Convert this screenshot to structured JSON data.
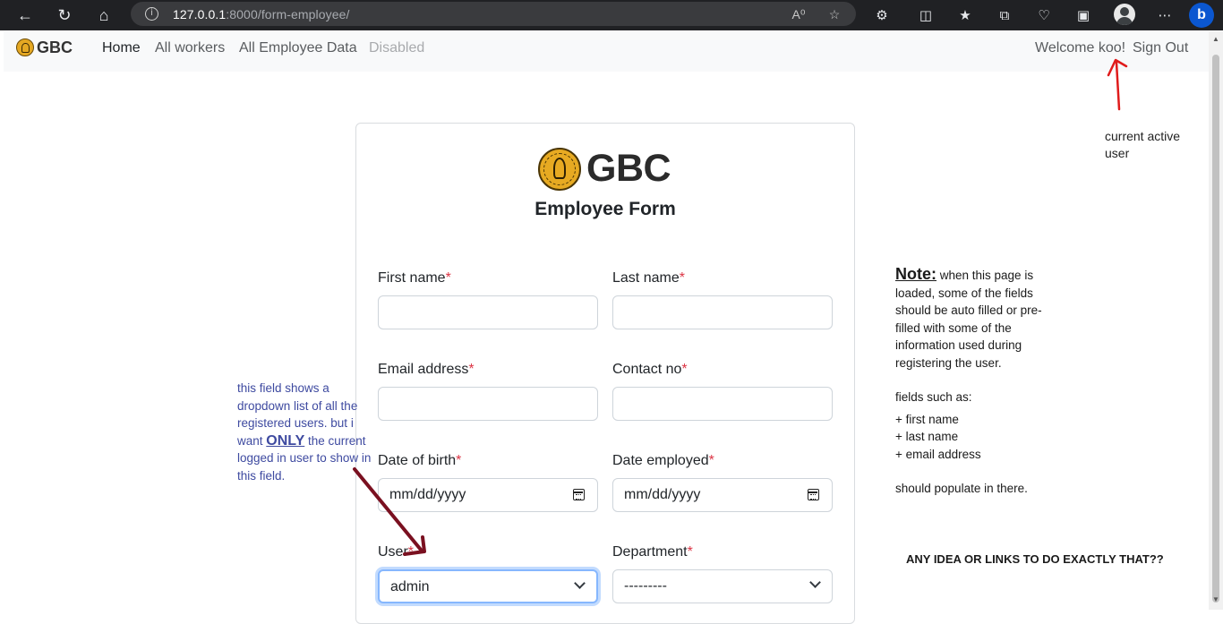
{
  "browser": {
    "url_host": "127.0.0.1",
    "url_rest": ":8000/form-employee/"
  },
  "navbar": {
    "brand": "GBC",
    "links": [
      "Home",
      "All workers",
      "All Employee Data",
      "Disabled"
    ],
    "welcome": "Welcome koo!",
    "signout": "Sign Out"
  },
  "form": {
    "logo_text": "GBC",
    "title": "Employee Form",
    "first_name_label": "First name",
    "last_name_label": "Last name",
    "email_label": "Email address",
    "contact_label": "Contact no",
    "dob_label": "Date of birth",
    "date_employed_label": "Date employed",
    "user_label": "User",
    "department_label": "Department",
    "required_mark": "*",
    "date_placeholder": "mm/dd/yyyy",
    "user_value": "admin",
    "department_value": "---------"
  },
  "annotations": {
    "left_part1": "this field shows a dropdown list of all the registered users. but i want ",
    "left_only": "ONLY",
    "left_part2": " the current logged in user to show in this field.",
    "top_right": "current active user",
    "note_title": "Note:",
    "note_body": " when this page is loaded, some of the fields should be auto filled or pre-filled with some of the information used during registering the user.",
    "note_fields_intro": "fields such as:",
    "note_items": [
      "+ first name",
      "+ last name",
      "+ email address"
    ],
    "note_end": "should populate in there.",
    "ask": "ANY IDEA OR LINKS TO DO EXACTLY THAT??"
  },
  "colors": {
    "required": "#dc3545",
    "annotation_blue": "#3e4aa0",
    "arrow_dark_red": "#7a1020",
    "arrow_red": "#e01b1b",
    "focus_ring": "#86b7fe"
  }
}
